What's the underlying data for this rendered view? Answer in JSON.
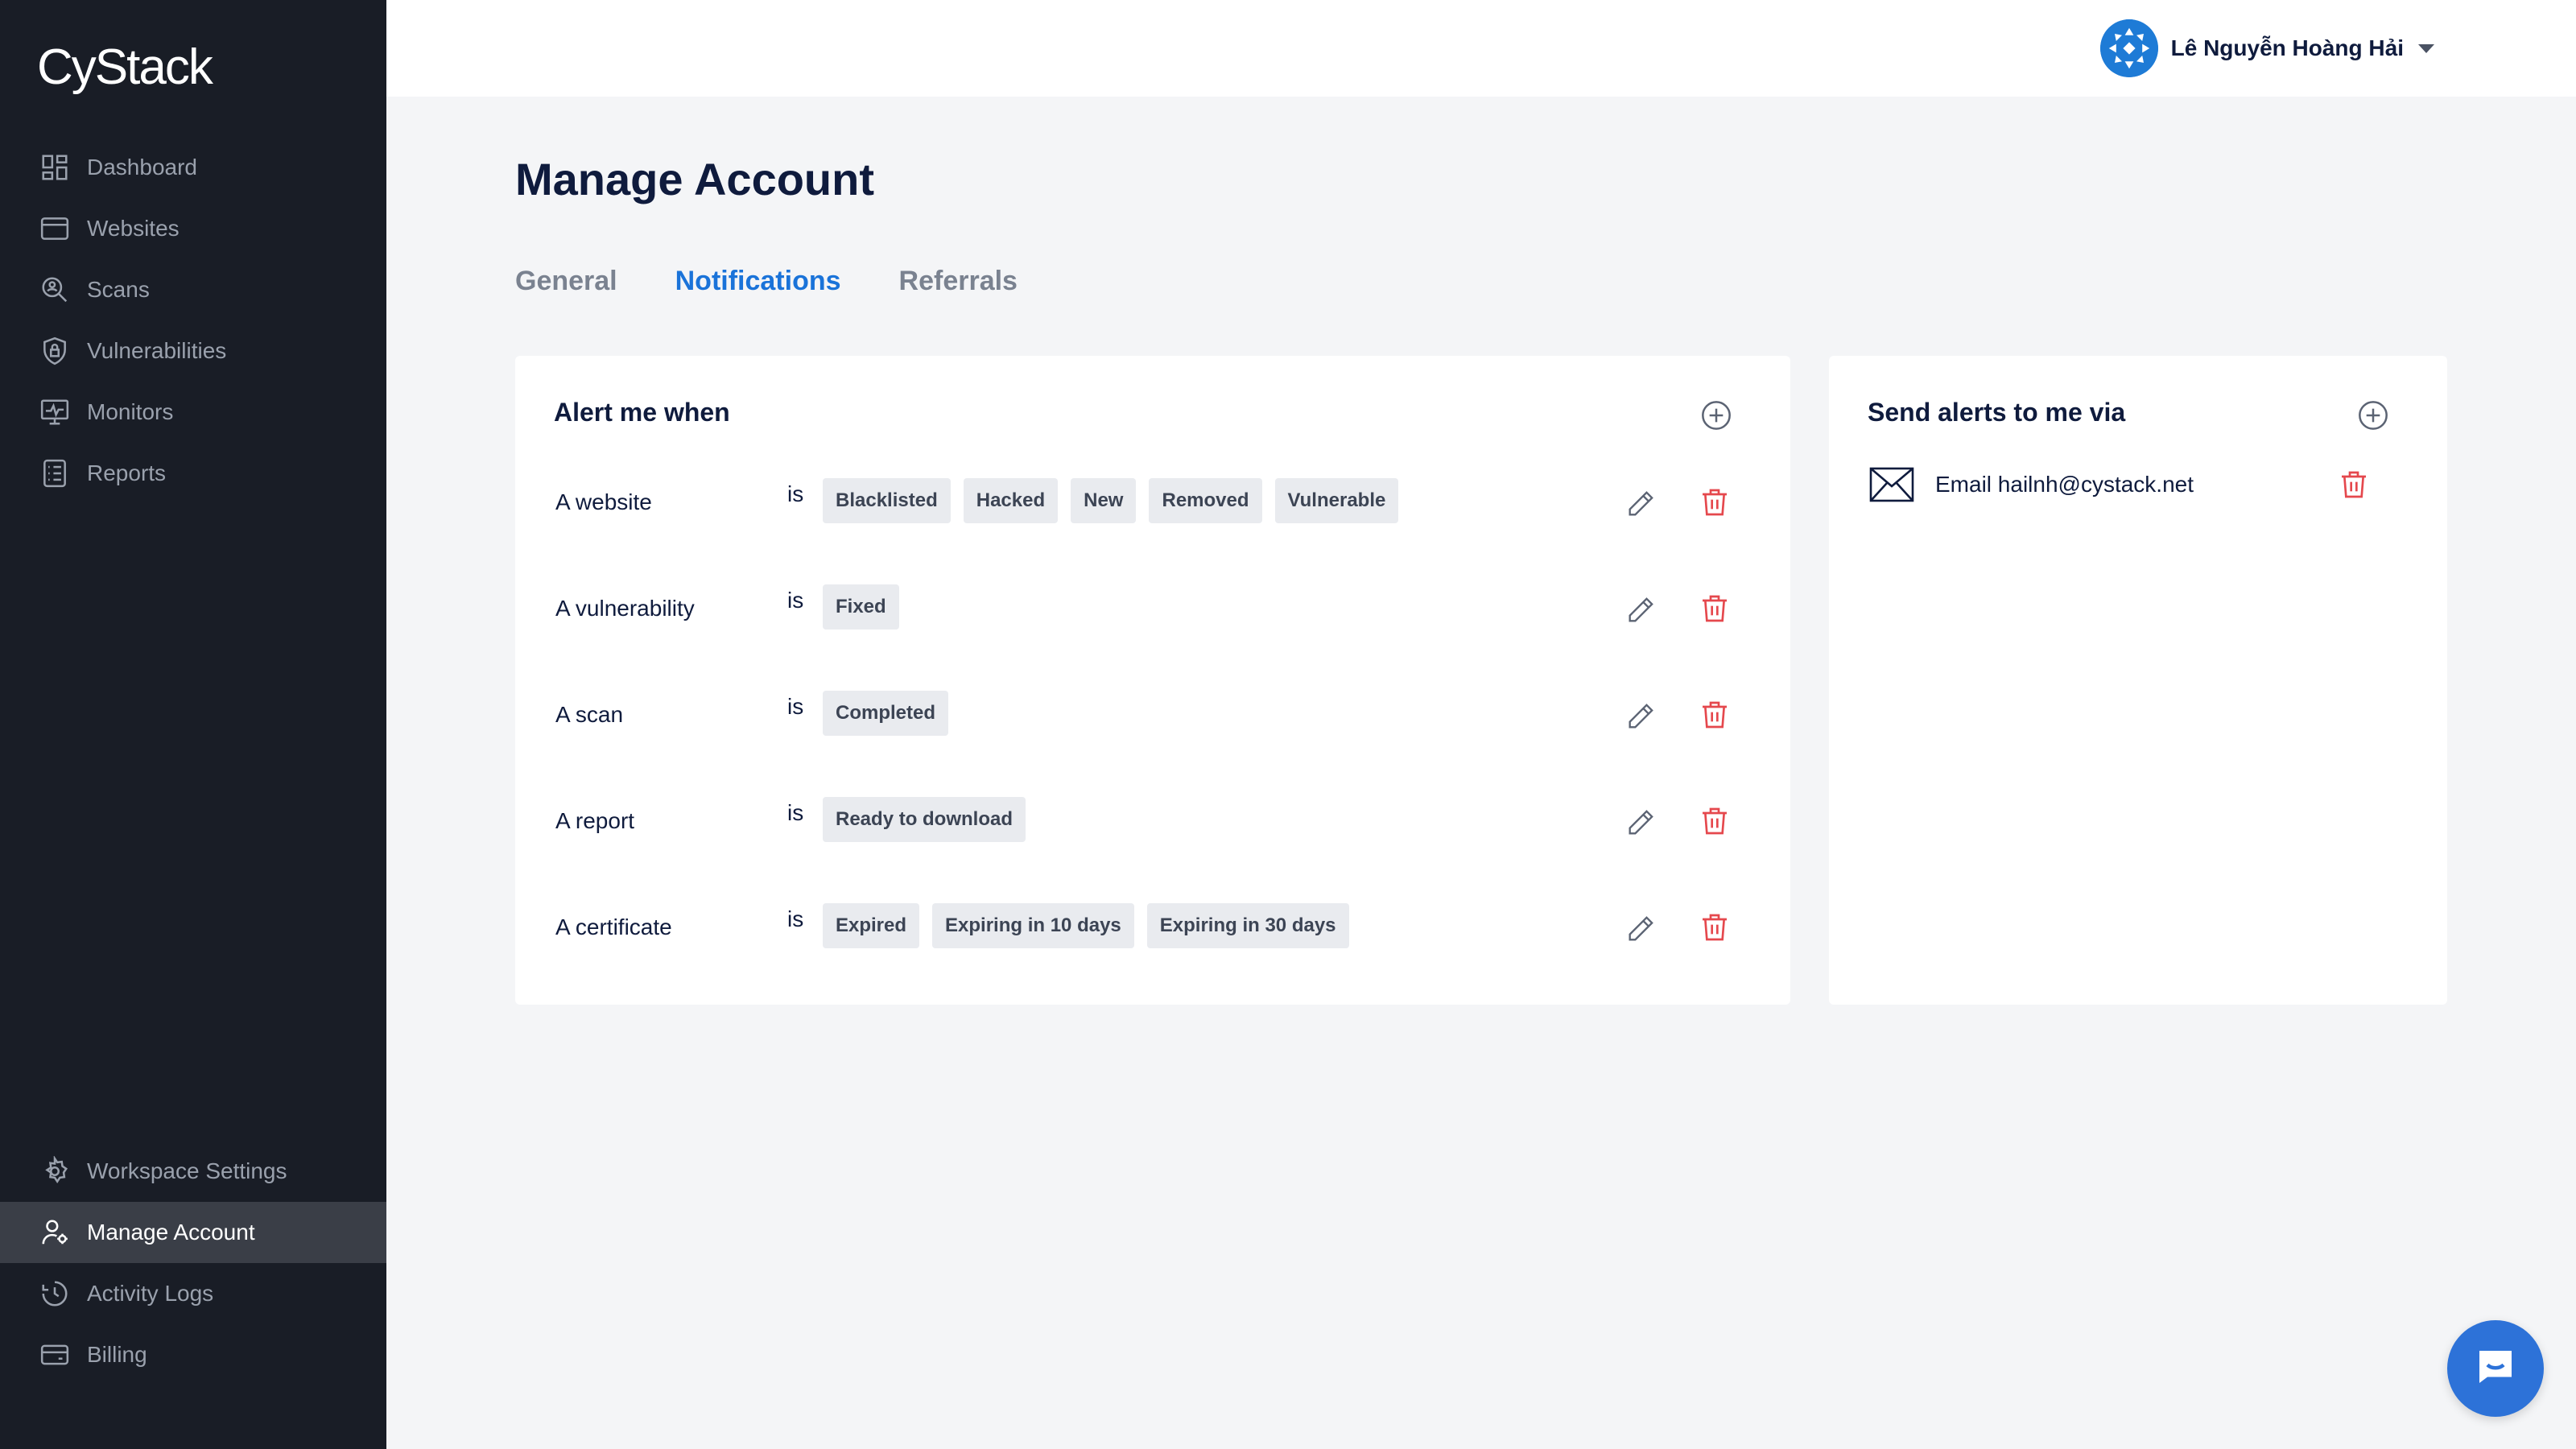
{
  "brand": {
    "logo_text": "CyStack"
  },
  "sidebar": {
    "top_items": [
      {
        "label": "Dashboard",
        "icon": "dashboard-icon"
      },
      {
        "label": "Websites",
        "icon": "browser-window-icon"
      },
      {
        "label": "Scans",
        "icon": "scan-magnifier-icon"
      },
      {
        "label": "Vulnerabilities",
        "icon": "shield-lock-icon"
      },
      {
        "label": "Monitors",
        "icon": "monitor-pulse-icon"
      },
      {
        "label": "Reports",
        "icon": "report-list-icon"
      }
    ],
    "bottom_items": [
      {
        "label": "Workspace Settings",
        "icon": "gear-icon"
      },
      {
        "label": "Manage Account",
        "icon": "user-gear-icon",
        "active": true
      },
      {
        "label": "Activity Logs",
        "icon": "clock-history-icon"
      },
      {
        "label": "Billing",
        "icon": "credit-card-icon"
      }
    ]
  },
  "topbar": {
    "user_name": "Lê Nguyễn Hoàng Hải"
  },
  "page": {
    "title": "Manage Account"
  },
  "tabs": [
    {
      "label": "General",
      "active": false
    },
    {
      "label": "Notifications",
      "active": true
    },
    {
      "label": "Referrals",
      "active": false
    }
  ],
  "alerts_card": {
    "title": "Alert me when",
    "connector": "is",
    "rules": [
      {
        "subject": "A website",
        "states": [
          "Blacklisted",
          "Hacked",
          "New",
          "Removed",
          "Vulnerable"
        ]
      },
      {
        "subject": "A vulnerability",
        "states": [
          "Fixed"
        ]
      },
      {
        "subject": "A scan",
        "states": [
          "Completed"
        ]
      },
      {
        "subject": "A report",
        "states": [
          "Ready to download"
        ]
      },
      {
        "subject": "A certificate",
        "states": [
          "Expired",
          "Expiring in 10 days",
          "Expiring in 30 days"
        ]
      }
    ]
  },
  "channels_card": {
    "title": "Send alerts to me via",
    "channels": [
      {
        "label": "Email hailnh@cystack.net",
        "icon": "envelope-icon"
      }
    ]
  },
  "colors": {
    "sidebar_bg": "#191d26",
    "sidebar_active_bg": "#3a3e47",
    "accent": "#1a73d9",
    "danger": "#e5484d",
    "tag_bg": "#e9ebef",
    "page_bg": "#f4f5f7"
  },
  "chat_widget": {
    "icon": "chat-bubble-icon"
  }
}
